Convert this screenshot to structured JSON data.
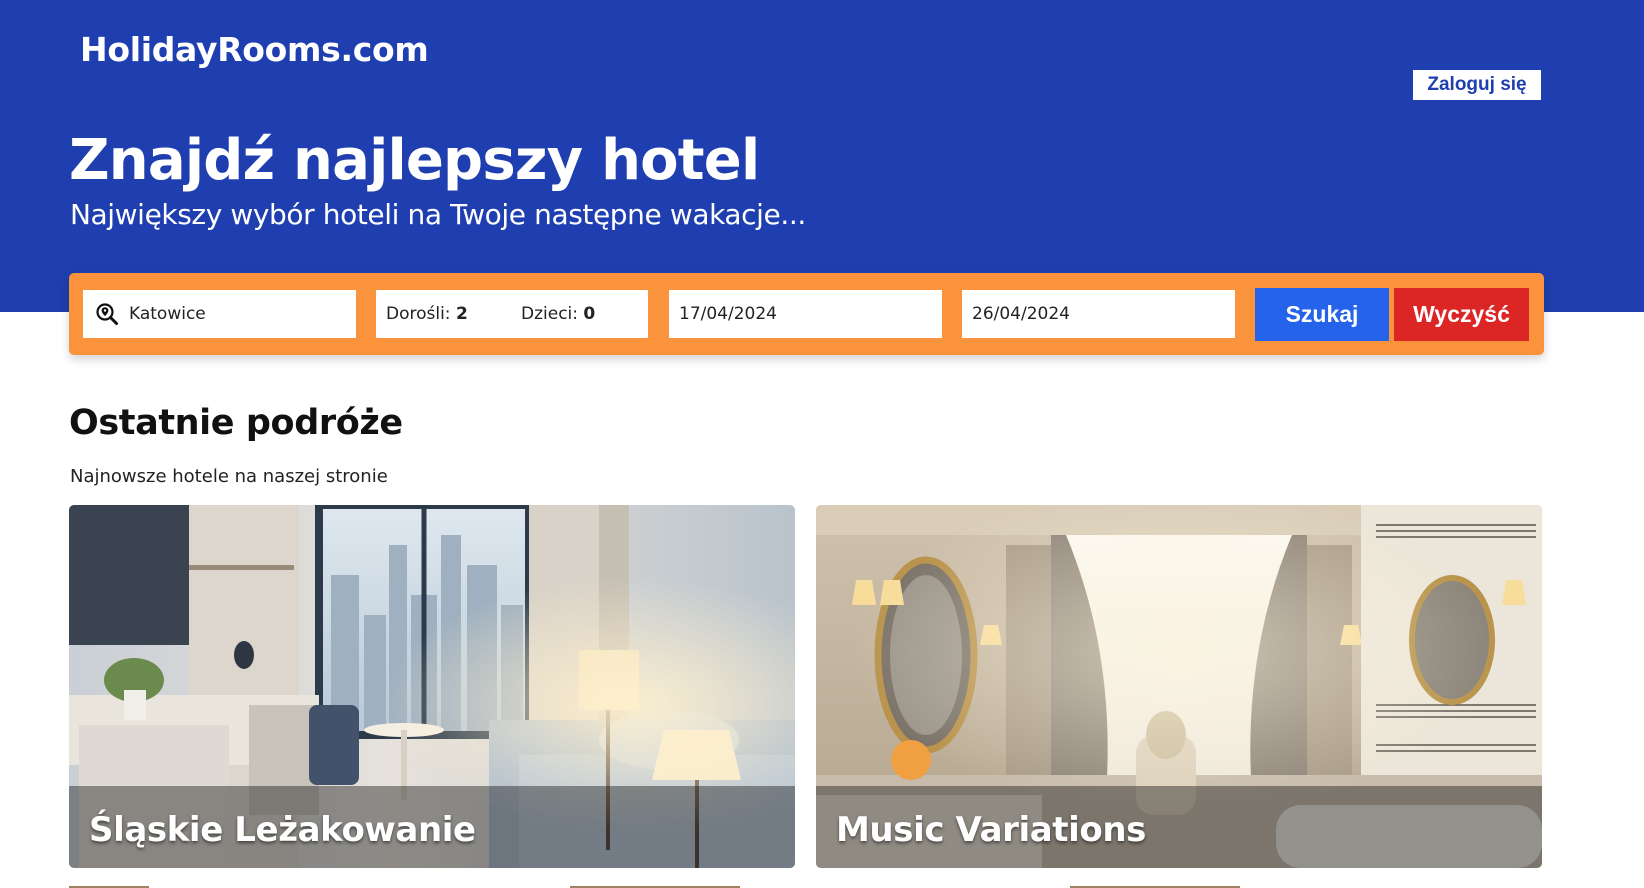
{
  "header": {
    "logo": "HolidayRooms.com",
    "login_label": "Zaloguj się",
    "title": "Znajdź najlepszy hotel",
    "subtitle": "Największy wybór hoteli na Twoje następne wakacje..."
  },
  "search": {
    "destination_value": "Katowice",
    "destination_icon": "search-location-icon",
    "adults_label": "Dorośli:",
    "adults_value": "2",
    "children_label": "Dzieci:",
    "children_value": "0",
    "checkin_value": "17/04/2024",
    "checkout_value": "26/04/2024",
    "search_label": "Szukaj",
    "clear_label": "Wyczyść"
  },
  "recent": {
    "title": "Ostatnie podróże",
    "subtitle": "Najnowsze hotele na naszej stronie",
    "cards": [
      {
        "name": "Śląskie Leżakowanie"
      },
      {
        "name": "Music Variations"
      }
    ]
  },
  "colors": {
    "hero_bg": "#1f3fb0",
    "search_bar": "#fb923c",
    "search_button": "#2563eb",
    "clear_button": "#dc2626"
  }
}
